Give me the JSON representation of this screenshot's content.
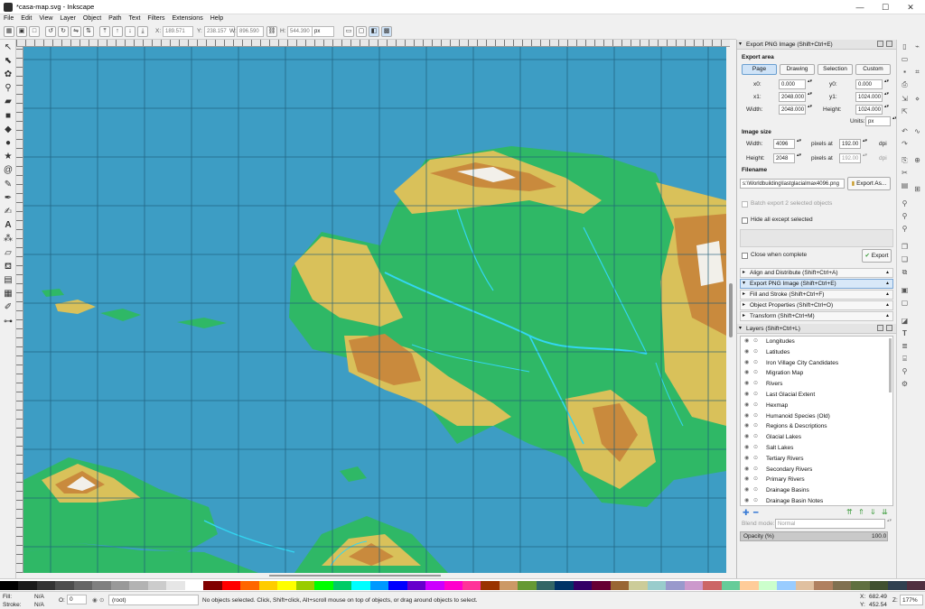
{
  "window": {
    "title": "*casa-map.svg - Inkscape",
    "controls": [
      "—",
      "☐",
      "✕"
    ]
  },
  "menu": [
    "File",
    "Edit",
    "View",
    "Layer",
    "Object",
    "Path",
    "Text",
    "Filters",
    "Extensions",
    "Help"
  ],
  "toolbar": {
    "x_label": "X:",
    "x_value": "189.571",
    "y_label": "Y:",
    "y_value": "238.157",
    "w_label": "W:",
    "w_value": "896.590",
    "h_label": "H:",
    "h_value": "544.390",
    "unit": "px"
  },
  "export_dialog": {
    "title": "Export PNG Image (Shift+Ctrl+E)",
    "area_heading": "Export area",
    "area_buttons": [
      "Page",
      "Drawing",
      "Selection",
      "Custom"
    ],
    "area_active": "Page",
    "x0_label": "x0:",
    "x0": "0.000",
    "y0_label": "y0:",
    "y0": "0.000",
    "x1_label": "x1:",
    "x1": "2048.000",
    "y1_label": "y1:",
    "y1": "1024.000",
    "width_label": "Width:",
    "width": "2048.000",
    "height_label": "Height:",
    "height": "1024.000",
    "units_label": "Units:",
    "units": "px",
    "size_heading": "Image size",
    "size_width_label": "Width:",
    "size_width": "4096",
    "size_height_label": "Height:",
    "size_height": "2048",
    "pixels_at": "pixels at",
    "dpi1": "192.00",
    "dpi2": "192.00",
    "dpi_unit": "dpi",
    "filename_heading": "Filename",
    "filename": "s:\\Worldbuilding\\lastglacialmax4096.png",
    "export_as": "Export As...",
    "batch": "Batch export 2 selected objects",
    "hide_all": "Hide all except selected",
    "close_when": "Close when complete",
    "export_button": "Export"
  },
  "docked_dialogs": [
    "Align and Distribute (Shift+Ctrl+A)",
    "Export PNG Image (Shift+Ctrl+E)",
    "Fill and Stroke (Shift+Ctrl+F)",
    "Object Properties (Shift+Ctrl+O)",
    "Transform (Shift+Ctrl+M)"
  ],
  "layers_dialog": {
    "title": "Layers (Shift+Ctrl+L)",
    "items": [
      "Longitudes",
      "Latitudes",
      "Iron Village City Candidates",
      "Migration Map",
      "Rivers",
      "Last Glacial Extent",
      "Hexmap",
      "Humanoid Species (Old)",
      "Regions & Descriptions",
      "Glacial Lakes",
      "Salt Lakes",
      "Tertiary Rivers",
      "Secondary Rivers",
      "Primary Rivers",
      "Drainage Basins",
      "Drainage Basin Notes"
    ],
    "blend_label": "Blend mode:",
    "blend_value": "Normal",
    "opacity_label": "Opacity (%)",
    "opacity_value": "100.0"
  },
  "status": {
    "fill_label": "Fill:",
    "fill_value": "N/A",
    "stroke_label": "Stroke:",
    "stroke_value": "N/A",
    "o_label": "O:",
    "o_value": "0",
    "layer": "(root)",
    "message": "No objects selected. Click, Shift+click, Alt+scroll mouse on top of objects, or drag around objects to select.",
    "x_label": "X:",
    "x": "682.49",
    "y_label": "Y:",
    "y": "452.54",
    "z_label": "Z:",
    "zoom": "177%"
  },
  "colors": {
    "ocean": "#3d9dc4",
    "lowland": "#2fb866",
    "hill": "#d9c15a",
    "upland": "#c98a3d",
    "mountain": "#f2f0ea",
    "river": "#33d6f2",
    "grid": "#1e5c78",
    "accent": "#6a9fd0"
  },
  "palette": [
    "#000000",
    "#1a1a1a",
    "#333333",
    "#4d4d4d",
    "#666666",
    "#808080",
    "#999999",
    "#b3b3b3",
    "#cccccc",
    "#e6e6e6",
    "#ffffff",
    "#800000",
    "#ff0000",
    "#ff6600",
    "#ffcc00",
    "#ffff00",
    "#99cc00",
    "#00ff00",
    "#00cc66",
    "#00ffff",
    "#0099ff",
    "#0000ff",
    "#6600cc",
    "#cc00ff",
    "#ff00cc",
    "#ff3399",
    "#993300",
    "#cc9966",
    "#669933",
    "#336666",
    "#003366",
    "#330066",
    "#660033",
    "#996633",
    "#cccc99",
    "#99cccc",
    "#9999cc",
    "#cc99cc",
    "#cc6666",
    "#66cc99",
    "#ffcc99",
    "#ccffcc",
    "#99ccff",
    "#e0c0a0",
    "#b08060",
    "#807050",
    "#607040",
    "#405030",
    "#304050",
    "#503040"
  ]
}
